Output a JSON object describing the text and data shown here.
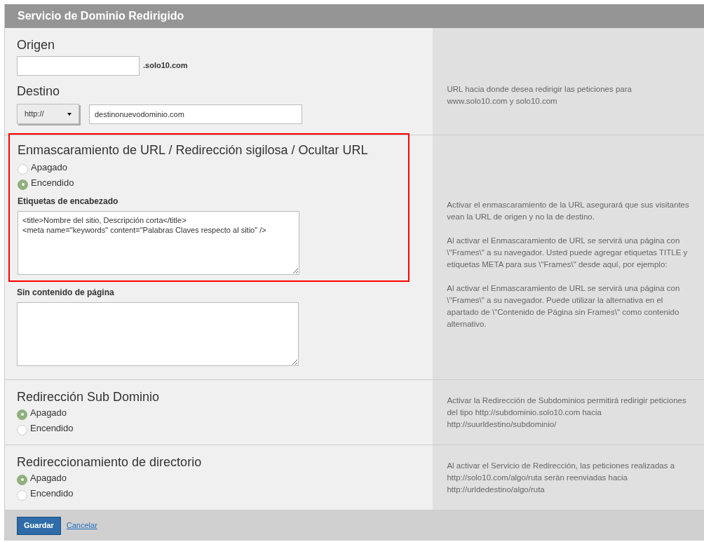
{
  "header": {
    "title": "Servicio de Dominio Redirigido"
  },
  "origin": {
    "heading": "Origen",
    "suffix": ".solo10.com"
  },
  "destination": {
    "heading": "Destino",
    "protocol": "http://",
    "value": "destinonuevodominio.com",
    "help": [
      "URL hacia donde desea redirigir las peticiones para www.solo10.com y solo10.com"
    ]
  },
  "masking": {
    "heading": "Enmascaramiento de URL / Redirección sigilosa / Ocultar URL",
    "highlighted": true,
    "options": [
      {
        "label": "Apagado",
        "selected": false
      },
      {
        "label": "Encendido",
        "selected": true
      }
    ],
    "header_tags": {
      "label": "Etiquetas de encabezado",
      "value": "<title>Nombre del sitio, Descripción corta</title>\n<meta name=\"keywords\" content=\"Palabras Claves respecto al sitio\" />"
    },
    "no_frames": {
      "label": "Sin contenido de página"
    },
    "help": [
      "Activar el enmascaramiento de la URL asegurará que sus visitantes vean la URL de origen y no la de destino.",
      "Al activar el Enmascaramiento de URL se servirá una página con \\\"Frames\\\" a su navegador. Usted puede agregar etiquetas TITLE y etiquetas META para sus \\\"Frames\\\" desde aquí, por ejemplo:",
      "Al activar el Enmascaramiento de URL se servirá una página con \\\"Frames\\\" a su navegador. Puede utilizar la alternativa en el apartado de \\\"Contenido de Página sin Frames\\\" como contenido alternativo."
    ]
  },
  "sections": [
    {
      "heading": "Redirección Sub Dominio",
      "options": [
        {
          "label": "Apagado",
          "selected": true
        },
        {
          "label": "Encendido",
          "selected": false
        }
      ],
      "help": [
        "Activar la Redirección de Subdominios permitirá redirigir peticiones del tipo http://subdominio.solo10.com hacia http://suurldestino/subdominio/"
      ]
    },
    {
      "heading": "Redireccionamiento de directorio",
      "options": [
        {
          "label": "Apagado",
          "selected": true
        },
        {
          "label": "Encendido",
          "selected": false
        }
      ],
      "help": [
        "Al activar el Servicio de Redirección, las peticiones realizadas a http://solo10.com/algo/ruta serán reenviadas hacia http://urldedestino/algo/ruta"
      ]
    }
  ],
  "footer": {
    "save": "Guardar",
    "cancel": "Cancelar"
  }
}
